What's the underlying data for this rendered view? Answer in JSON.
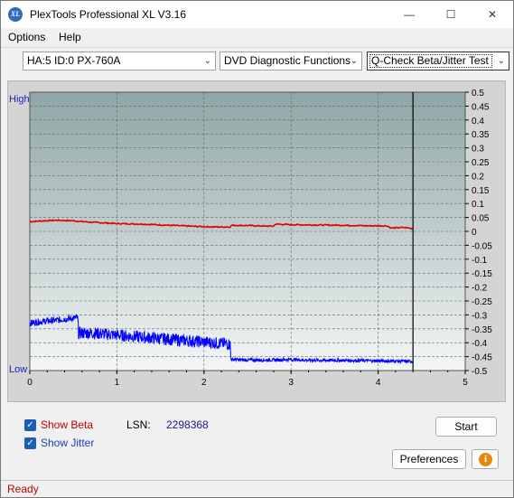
{
  "window": {
    "title": "PlexTools Professional XL V3.16",
    "icon_text": "XL",
    "minimize": "—",
    "maximize": "☐",
    "close": "✕"
  },
  "menu": {
    "items": [
      "Options",
      "Help"
    ]
  },
  "toolbar": {
    "drive": "HA:5 ID:0  PX-760A",
    "function": "DVD Diagnostic Functions",
    "test": "Q-Check Beta/Jitter Test"
  },
  "chart": {
    "left_high": "High",
    "left_low": "Low",
    "x_ticks": [
      "0",
      "1",
      "2",
      "3",
      "4",
      "5"
    ],
    "y_ticks": [
      "0.5",
      "0.45",
      "0.4",
      "0.35",
      "0.3",
      "0.25",
      "0.2",
      "0.15",
      "0.1",
      "0.05",
      "0",
      "-0.05",
      "-0.1",
      "-0.15",
      "-0.2",
      "-0.25",
      "-0.3",
      "-0.35",
      "-0.4",
      "-0.45",
      "-0.5"
    ],
    "colors": {
      "beta": "#e00000",
      "jitter": "#0000ff",
      "background_top": "#8fa5a5",
      "background_bottom": "#f4f6f6"
    }
  },
  "chart_data": {
    "type": "line",
    "xlim": [
      0,
      5
    ],
    "ylim": [
      -0.5,
      0.5
    ],
    "grid": true,
    "end_marker_x": 4.4,
    "series": [
      {
        "name": "Show Beta",
        "color": "#e00000",
        "x": [
          0,
          0.1,
          0.3,
          0.5,
          0.7,
          1.0,
          1.3,
          1.6,
          1.9,
          2.1,
          2.3,
          2.32,
          2.5,
          2.7,
          2.8,
          2.82,
          3.0,
          3.3,
          3.6,
          3.9,
          4.1,
          4.15,
          4.3,
          4.4
        ],
        "y": [
          0.035,
          0.037,
          0.04,
          0.038,
          0.033,
          0.028,
          0.026,
          0.022,
          0.018,
          0.016,
          0.016,
          0.022,
          0.021,
          0.019,
          0.019,
          0.026,
          0.024,
          0.023,
          0.022,
          0.02,
          0.02,
          0.012,
          0.014,
          0.01
        ]
      },
      {
        "name": "Show Jitter",
        "color": "#0000ff",
        "x": [
          0,
          0.1,
          0.2,
          0.3,
          0.4,
          0.5,
          0.55,
          0.56,
          0.7,
          0.9,
          1.1,
          1.3,
          1.5,
          1.7,
          1.9,
          2.1,
          2.3,
          2.31,
          2.5,
          2.8,
          3.0,
          3.2,
          3.5,
          3.8,
          4.0,
          4.2,
          4.4
        ],
        "y": [
          -0.33,
          -0.325,
          -0.322,
          -0.32,
          -0.315,
          -0.312,
          -0.31,
          -0.365,
          -0.365,
          -0.37,
          -0.375,
          -0.38,
          -0.385,
          -0.39,
          -0.395,
          -0.4,
          -0.405,
          -0.46,
          -0.462,
          -0.462,
          -0.46,
          -0.463,
          -0.463,
          -0.464,
          -0.465,
          -0.466,
          -0.467
        ],
        "spread": [
          0.012,
          0.012,
          0.012,
          0.012,
          0.012,
          0.012,
          0.012,
          0.022,
          0.022,
          0.022,
          0.022,
          0.022,
          0.022,
          0.022,
          0.022,
          0.022,
          0.022,
          0.006,
          0.006,
          0.006,
          0.006,
          0.006,
          0.006,
          0.006,
          0.006,
          0.006,
          0.006
        ]
      }
    ]
  },
  "bottom": {
    "show_beta": "Show Beta",
    "show_beta_mnemonic": "B",
    "show_jitter": "Show Jitter",
    "show_jitter_mnemonic": "J",
    "lsn_label": "LSN:",
    "lsn_value": "2298368",
    "start": "Start",
    "preferences": "Preferences",
    "info_icon": "i"
  },
  "status": {
    "text": "Ready"
  }
}
